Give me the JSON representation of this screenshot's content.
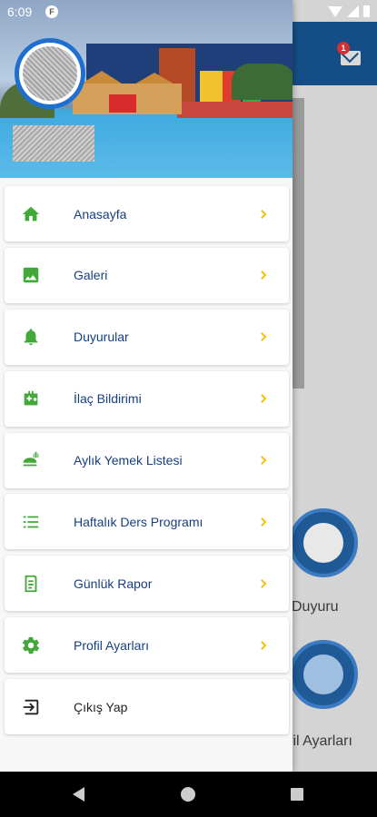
{
  "status_bar": {
    "time": "6:09",
    "app_icon_letter": "F"
  },
  "app": {
    "mail_badge_count": "1",
    "tiles": [
      {
        "label": "Duyuru"
      },
      {
        "label": "fil Ayarları"
      }
    ]
  },
  "drawer": {
    "menu": [
      {
        "label": "Anasayfa",
        "icon": "home-icon"
      },
      {
        "label": "Galeri",
        "icon": "image-icon"
      },
      {
        "label": "Duyurular",
        "icon": "bell-icon"
      },
      {
        "label": "İlaç Bildirimi",
        "icon": "medical-bag-icon"
      },
      {
        "label": "Aylık Yemek Listesi",
        "icon": "food-icon"
      },
      {
        "label": "Haftalık Ders Programı",
        "icon": "list-icon"
      },
      {
        "label": "Günlük Rapor",
        "icon": "report-icon"
      },
      {
        "label": "Profil Ayarları",
        "icon": "gear-icon"
      },
      {
        "label": "Çıkış Yap",
        "icon": "logout-icon"
      }
    ]
  },
  "colors": {
    "accent_green": "#43a83a",
    "label_blue": "#173f82",
    "chevron_yellow": "#f1c40f",
    "header_blue": "#154d86"
  }
}
